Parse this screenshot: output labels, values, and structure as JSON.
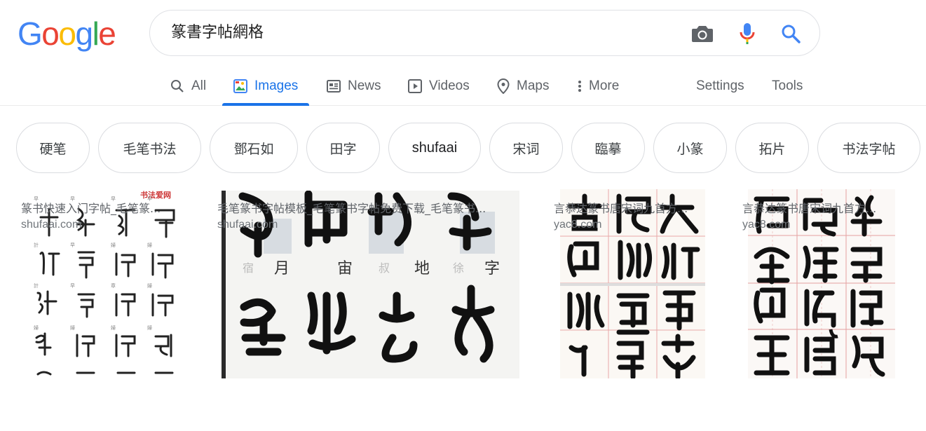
{
  "logo": {
    "letters": [
      {
        "ch": "G",
        "color": "#4285F4"
      },
      {
        "ch": "o",
        "color": "#EA4335"
      },
      {
        "ch": "o",
        "color": "#FBBC05"
      },
      {
        "ch": "g",
        "color": "#4285F4"
      },
      {
        "ch": "l",
        "color": "#34A853"
      },
      {
        "ch": "e",
        "color": "#EA4335"
      }
    ]
  },
  "search": {
    "query": "篆書字帖網格",
    "icons": [
      "camera-icon",
      "microphone-icon",
      "search-icon"
    ]
  },
  "tabs": [
    {
      "label": "All",
      "icon": "search-icon",
      "active": false
    },
    {
      "label": "Images",
      "icon": "image-icon",
      "active": true
    },
    {
      "label": "News",
      "icon": "news-icon",
      "active": false
    },
    {
      "label": "Videos",
      "icon": "play-icon",
      "active": false
    },
    {
      "label": "Maps",
      "icon": "map-pin-icon",
      "active": false
    },
    {
      "label": "More",
      "icon": "more-vertical-icon",
      "active": false
    },
    {
      "label": "Settings",
      "active": false
    },
    {
      "label": "Tools",
      "active": false
    }
  ],
  "colors": {
    "accent": "#1a73e8",
    "text_muted": "#5f6368",
    "border": "#dadce0"
  },
  "chips": [
    "硬笔",
    "毛笔书法",
    "鄧石如",
    "田字",
    "shufaai",
    "宋词",
    "臨摹",
    "小篆",
    "拓片",
    "书法字帖"
  ],
  "results": [
    {
      "title": "篆书快速入门字帖_毛笔篆...",
      "site": "shufaai.com",
      "image_header": "书法爱网"
    },
    {
      "title": "毛笔篆书字帖模板_毛笔篆书字帖免费下载_毛笔篆书...",
      "site": "shufaai.com",
      "image_labels": [
        "月",
        "宙",
        "地",
        "字"
      ]
    },
    {
      "title": "言恭达篆书唐宋词九首方...",
      "site": "yac8.com"
    },
    {
      "title": "言恭达篆书唐宋词九首方...",
      "site": "yac8.com"
    }
  ]
}
